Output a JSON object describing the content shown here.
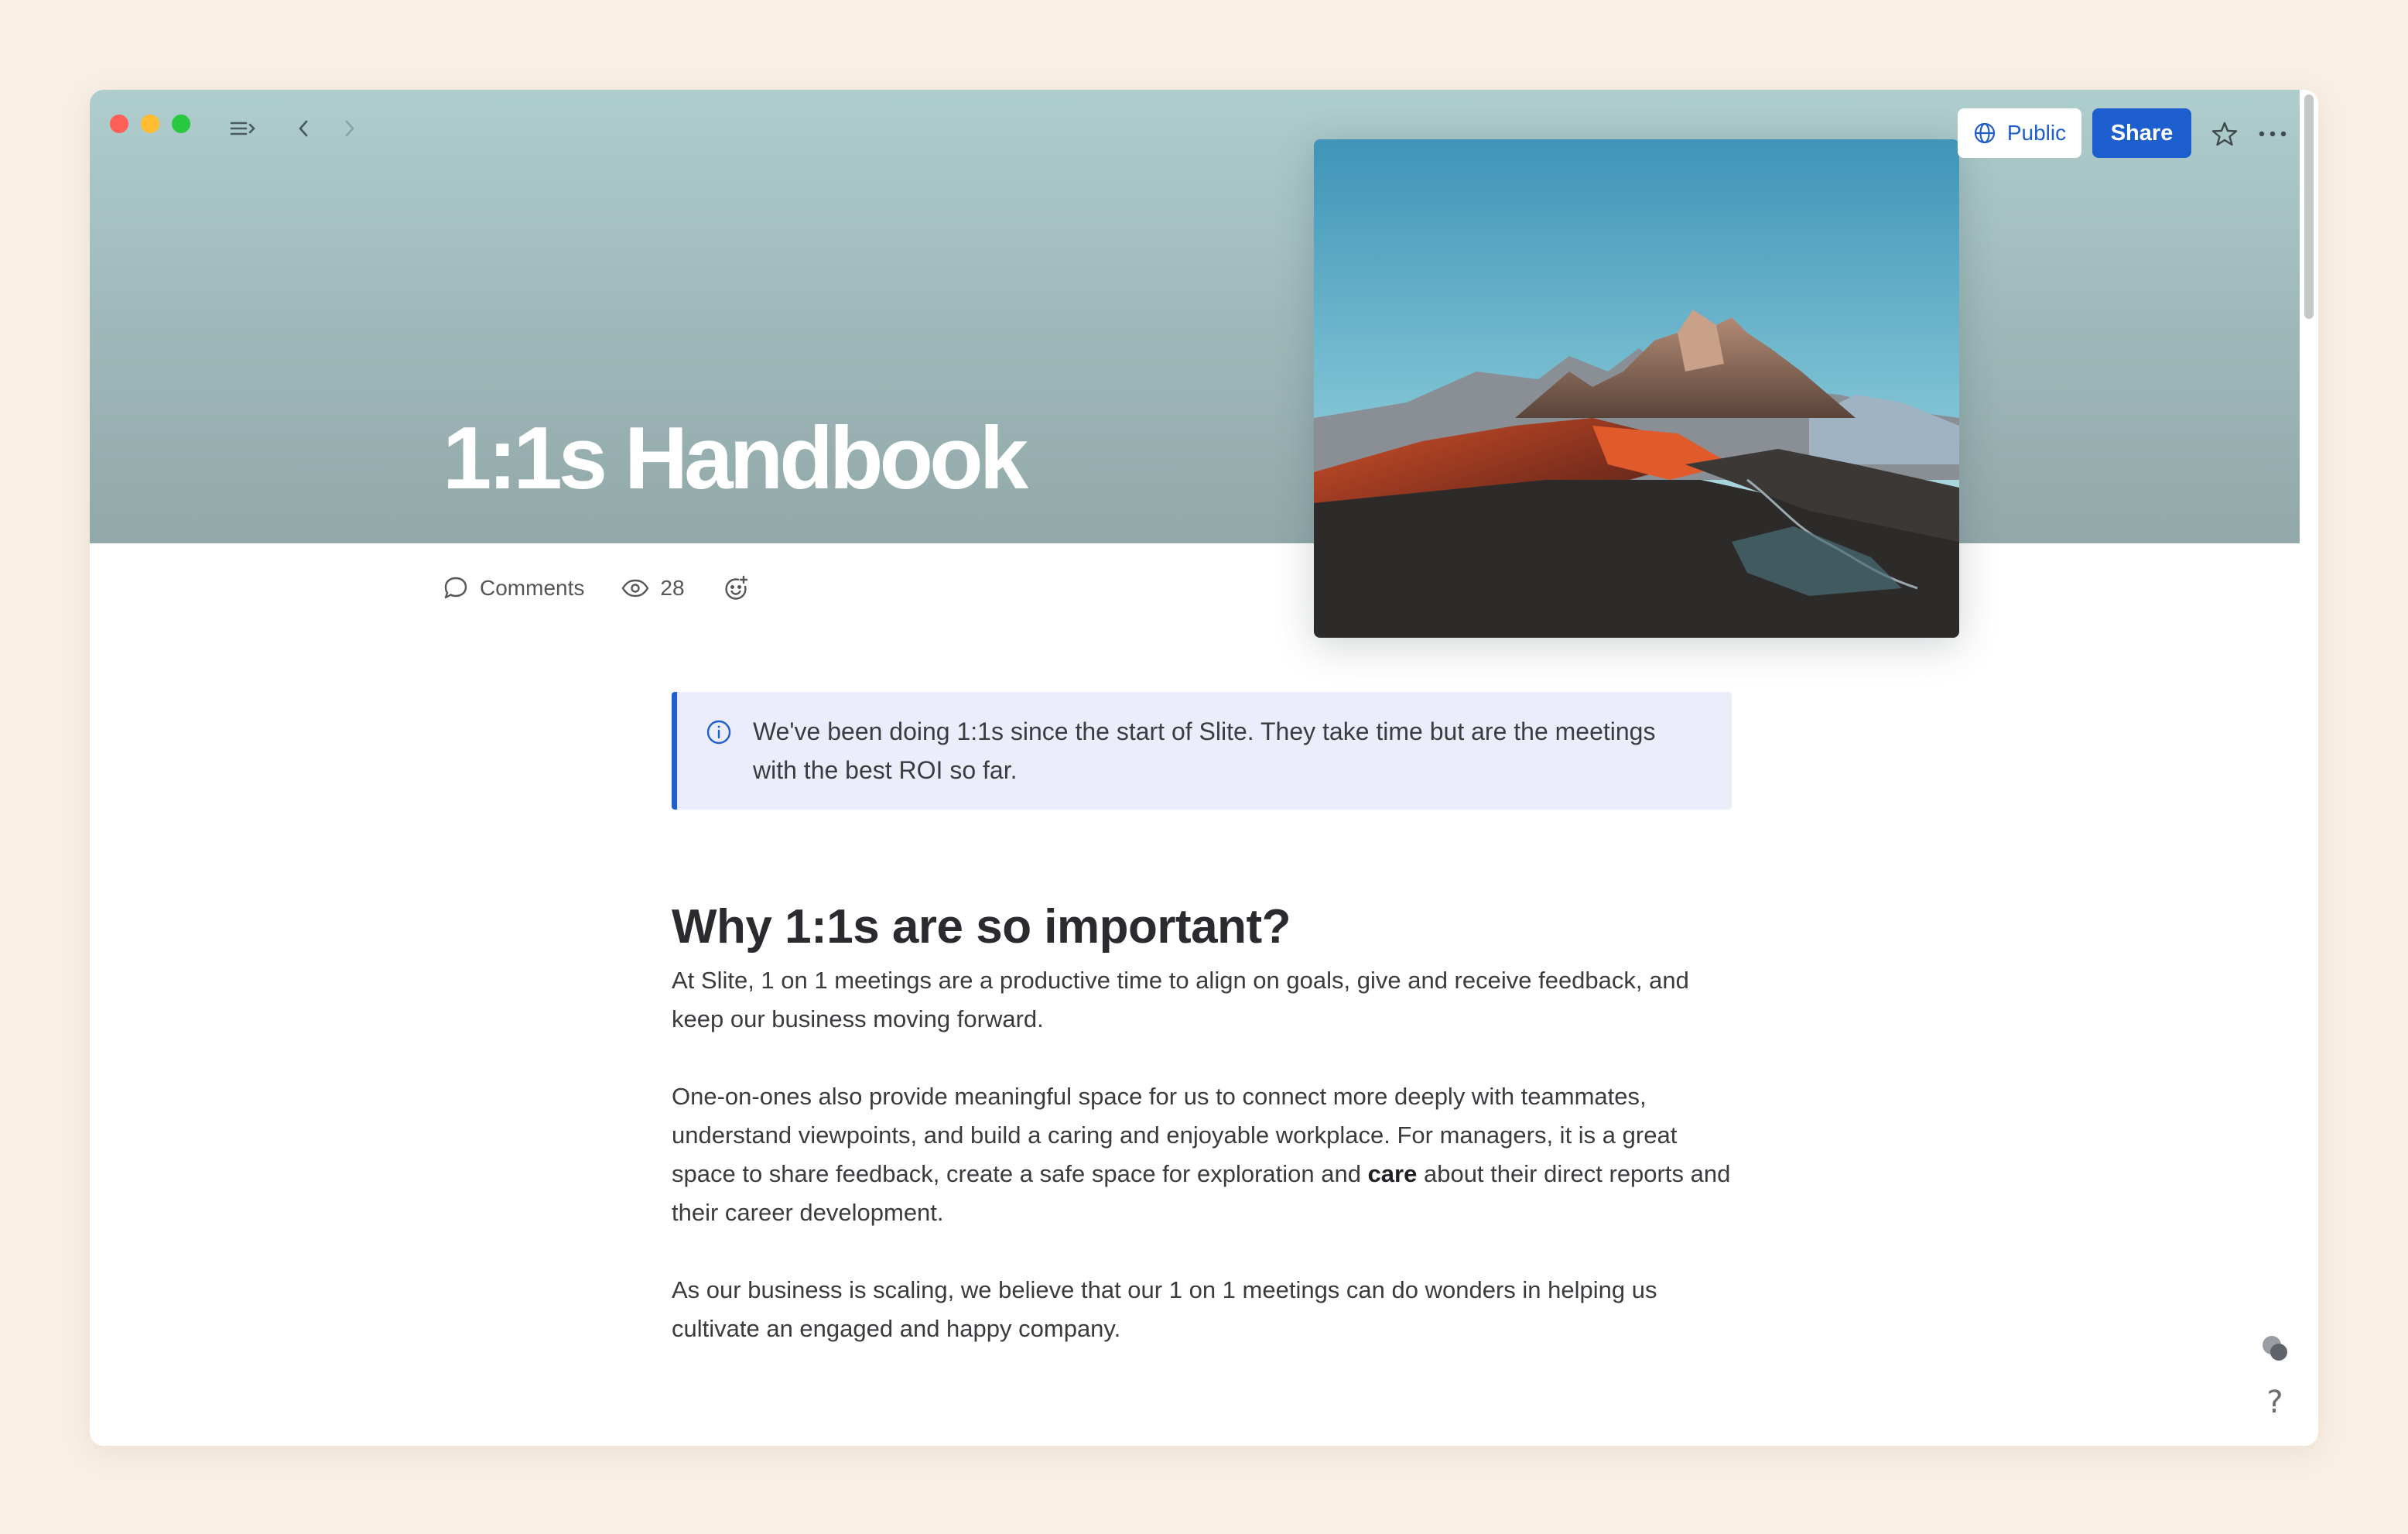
{
  "window": {
    "colors": {
      "cover_top": "#aecdcd",
      "cover_bottom": "#92a8a9",
      "accent": "#1d5fcf",
      "callout_bg": "#ebedfa"
    }
  },
  "toolbar": {
    "public_label": "Public",
    "share_label": "Share"
  },
  "doc": {
    "title": "1:1s Handbook",
    "meta": {
      "comments_label": "Comments",
      "views_count": "28"
    },
    "callout": {
      "text": "We've been doing 1:1s since the start of Slite. They take time but are the meetings with the best ROI so far."
    },
    "heading": "Why 1:1s are so important?",
    "para1": "At Slite, 1 on 1 meetings are a productive time to align on goals, give and receive feedback, and keep our business moving forward.",
    "para2_start": "One-on-ones also provide meaningful space for us to connect more deeply with teammates, understand viewpoints, and build a caring and enjoyable workplace. For managers, it is a great space to share feedback, create a safe space for exploration and ",
    "para2_bold": "care",
    "para2_end": " about their direct reports and their career development.",
    "para3": "As our business is scaling, we believe that our 1 on 1 meetings can do wonders in helping us cultivate an engaged and happy company."
  },
  "side": {
    "help_label": "?"
  }
}
